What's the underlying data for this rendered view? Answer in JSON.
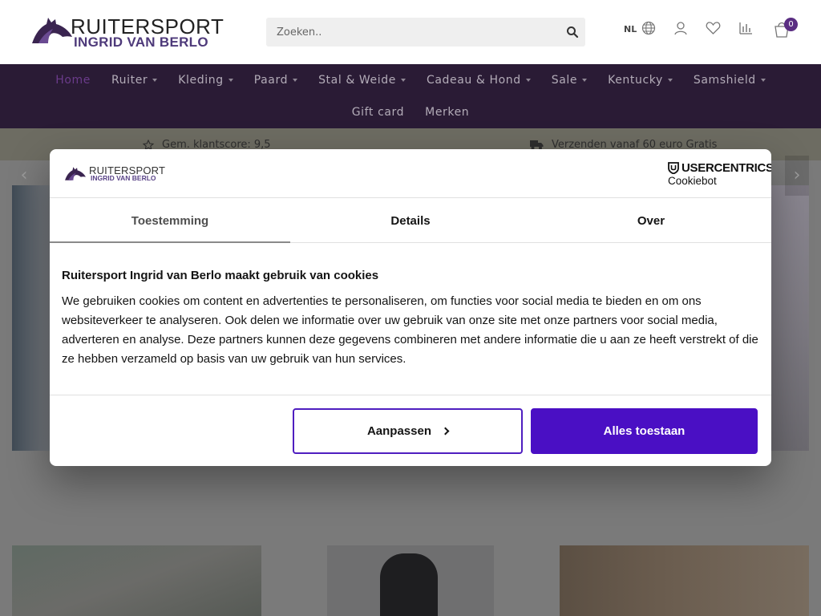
{
  "header": {
    "logo": {
      "line1": "RUITERSPORT",
      "line2": "INGRID VAN BERLO"
    },
    "search": {
      "placeholder": "Zoeken.."
    },
    "language": "NL",
    "cart_count": "0"
  },
  "nav": {
    "row1": [
      {
        "label": "Home",
        "caret": false,
        "active": true
      },
      {
        "label": "Ruiter",
        "caret": true
      },
      {
        "label": "Kleding",
        "caret": true
      },
      {
        "label": "Paard",
        "caret": true
      },
      {
        "label": "Stal & Weide",
        "caret": true
      },
      {
        "label": "Cadeau & Hond",
        "caret": true
      },
      {
        "label": "Sale",
        "caret": true
      },
      {
        "label": "Kentucky",
        "caret": true
      },
      {
        "label": "Samshield",
        "caret": true
      }
    ],
    "row2": [
      {
        "label": "Gift card",
        "caret": false
      },
      {
        "label": "Merken",
        "caret": false
      }
    ]
  },
  "usp": {
    "rating": "Gem. klantscore: 9,5",
    "shipping": "Verzenden vanaf 60 euro Gratis"
  },
  "cookie_dialog": {
    "logo": {
      "line1": "RUITERSPORT",
      "line2": "INGRID VAN BERLO"
    },
    "provider": {
      "brand": "USERCENTRICS",
      "product": "Cookiebot"
    },
    "tabs": [
      "Toestemming",
      "Details",
      "Over"
    ],
    "active_tab": "Toestemming",
    "heading": "Ruitersport Ingrid van Berlo maakt gebruik van cookies",
    "text": "We gebruiken cookies om content en advertenties te personaliseren, om functies voor social media te bieden en om ons websiteverkeer te analyseren. Ook delen we informatie over uw gebruik van onze site met onze partners voor social media, adverteren en analyse. Deze partners kunnen deze gegevens combineren met andere informatie die u aan ze heeft verstrekt of die ze hebben verzameld op basis van uw gebruik van hun services.",
    "buttons": {
      "customize": "Aanpassen",
      "allow_all": "Alles toestaan"
    },
    "colors": {
      "accent": "#4a0fc4"
    }
  }
}
